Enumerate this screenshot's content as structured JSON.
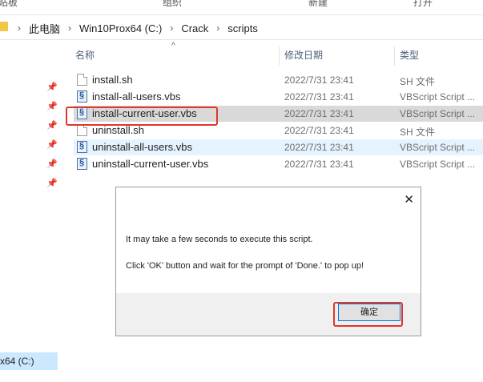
{
  "ribbon": {
    "groups": [
      "剪贴板",
      "组织",
      "新建",
      "打开"
    ]
  },
  "address": {
    "crumbs": [
      "此电脑",
      "Win10Prox64 (C:)",
      "Crack",
      "scripts"
    ],
    "separator": "›"
  },
  "nav": {
    "drive_label": "x64 (C:)"
  },
  "columns": {
    "name": "名称",
    "date": "修改日期",
    "type": "类型"
  },
  "files": [
    {
      "name": "install.sh",
      "date": "2022/7/31 23:41",
      "type": "SH 文件",
      "icon": "sh-file-icon"
    },
    {
      "name": "install-all-users.vbs",
      "date": "2022/7/31 23:41",
      "type": "VBScript Script ...",
      "icon": "vbs-file-icon"
    },
    {
      "name": "install-current-user.vbs",
      "date": "2022/7/31 23:41",
      "type": "VBScript Script ...",
      "icon": "vbs-file-icon"
    },
    {
      "name": "uninstall.sh",
      "date": "2022/7/31 23:41",
      "type": "SH 文件",
      "icon": "sh-file-icon"
    },
    {
      "name": "uninstall-all-users.vbs",
      "date": "2022/7/31 23:41",
      "type": "VBScript Script ...",
      "icon": "vbs-file-icon"
    },
    {
      "name": "uninstall-current-user.vbs",
      "date": "2022/7/31 23:41",
      "type": "VBScript Script ...",
      "icon": "vbs-file-icon"
    }
  ],
  "dialog": {
    "message_line1": "It may take a few seconds to execute this script.",
    "message_line2": "Click 'OK' button and wait for the prompt of 'Done.' to pop up!",
    "ok_label": "确定",
    "close_symbol": "✕"
  },
  "colors": {
    "highlight": "#e0362a",
    "selected_row": "#d9d9d9",
    "hover_row": "#e5f3ff",
    "accent": "#0078d7"
  }
}
